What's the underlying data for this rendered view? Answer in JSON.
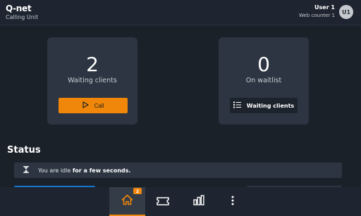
{
  "header": {
    "logo_text": "Q-net",
    "subtitle": "Calling Unit",
    "user_name": "User 1",
    "counter": "Web counter 1",
    "avatar_initials": "U1"
  },
  "cards": {
    "waiting": {
      "count": "2",
      "label": "Waiting clients",
      "button_label": "Call"
    },
    "waitlist": {
      "count": "0",
      "label": "On waitlist",
      "button_label": "Waiting clients"
    }
  },
  "status": {
    "title": "Status",
    "message_prefix": "You are idle",
    "message_bold": "for a few seconds."
  },
  "bottom_nav": {
    "home_badge": "2",
    "items": [
      {
        "icon": "home-icon",
        "active": true
      },
      {
        "icon": "ticket-icon",
        "active": false
      },
      {
        "icon": "stats-icon",
        "active": false
      },
      {
        "icon": "more-icon",
        "active": false
      }
    ]
  },
  "colors": {
    "accent": "#f0860a",
    "background": "#1b2129",
    "card": "#2c3541",
    "header": "#1e2530"
  }
}
